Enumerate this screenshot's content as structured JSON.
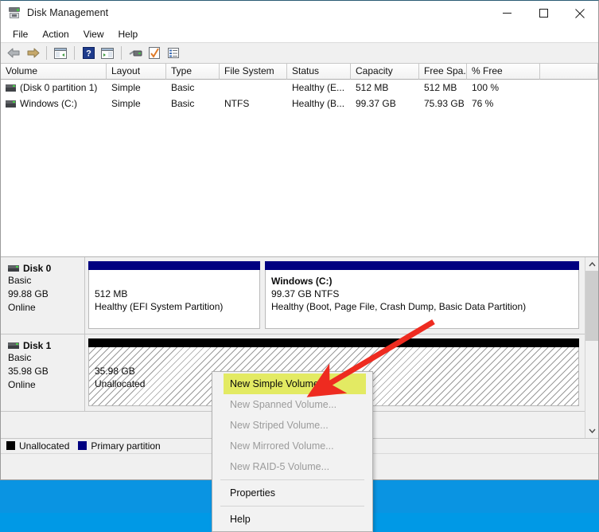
{
  "window": {
    "title": "Disk Management",
    "app_icon": "disk-drive-icon",
    "controls": {
      "minimize": "minimize-icon",
      "maximize": "maximize-icon",
      "close": "close-icon"
    }
  },
  "menubar": {
    "items": [
      "File",
      "Action",
      "View",
      "Help"
    ]
  },
  "toolbar": {
    "items": [
      "back-arrow-icon",
      "forward-arrow-icon",
      "separator",
      "show-hide-console-tree-icon",
      "separator",
      "help-icon",
      "show-hide-action-pane-icon",
      "separator",
      "rescan-disks-icon",
      "properties-icon",
      "list-view-icon"
    ]
  },
  "volume_list": {
    "columns": [
      "Volume",
      "Layout",
      "Type",
      "File System",
      "Status",
      "Capacity",
      "Free Spa...",
      "% Free"
    ],
    "rows": [
      {
        "volume": "(Disk 0 partition 1)",
        "layout": "Simple",
        "type": "Basic",
        "file_system": "",
        "status": "Healthy (E...",
        "capacity": "512 MB",
        "free_space": "512 MB",
        "percent_free": "100 %"
      },
      {
        "volume": "Windows (C:)",
        "layout": "Simple",
        "type": "Basic",
        "file_system": "NTFS",
        "status": "Healthy (B...",
        "capacity": "99.37 GB",
        "free_space": "75.93 GB",
        "percent_free": "76 %"
      }
    ]
  },
  "disks": [
    {
      "name": "Disk 0",
      "type": "Basic",
      "size": "99.88 GB",
      "state": "Online",
      "partitions": [
        {
          "label": "",
          "size": "512 MB",
          "status": "Healthy (EFI System Partition)",
          "kind": "primary"
        },
        {
          "label": "Windows  (C:)",
          "size": "99.37 GB NTFS",
          "status": "Healthy (Boot, Page File, Crash Dump, Basic Data Partition)",
          "kind": "primary"
        }
      ]
    },
    {
      "name": "Disk 1",
      "type": "Basic",
      "size": "35.98 GB",
      "state": "Online",
      "partitions": [
        {
          "label": "",
          "size": "35.98 GB",
          "status": "Unallocated",
          "kind": "unallocated"
        }
      ]
    }
  ],
  "legend": [
    {
      "label": "Unallocated",
      "color": "#000000"
    },
    {
      "label": "Primary partition",
      "color": "#000080"
    }
  ],
  "context_menu": {
    "items": [
      {
        "label": "New Simple Volume...",
        "state": "highlighted"
      },
      {
        "label": "New Spanned Volume...",
        "state": "disabled"
      },
      {
        "label": "New Striped Volume...",
        "state": "disabled"
      },
      {
        "label": "New Mirrored Volume...",
        "state": "disabled"
      },
      {
        "label": "New RAID-5 Volume...",
        "state": "disabled"
      },
      {
        "label": "separator",
        "state": "separator"
      },
      {
        "label": "Properties",
        "state": "enabled"
      },
      {
        "label": "separator",
        "state": "separator"
      },
      {
        "label": "Help",
        "state": "enabled"
      }
    ]
  },
  "annotation": {
    "type": "red-arrow",
    "color": "#ee2b20",
    "points_to": "New Simple Volume..."
  },
  "colors": {
    "primary_partition": "#000080",
    "unallocated": "#000000",
    "highlight": "#e3ea63",
    "desktop": "#0b9ae8"
  }
}
